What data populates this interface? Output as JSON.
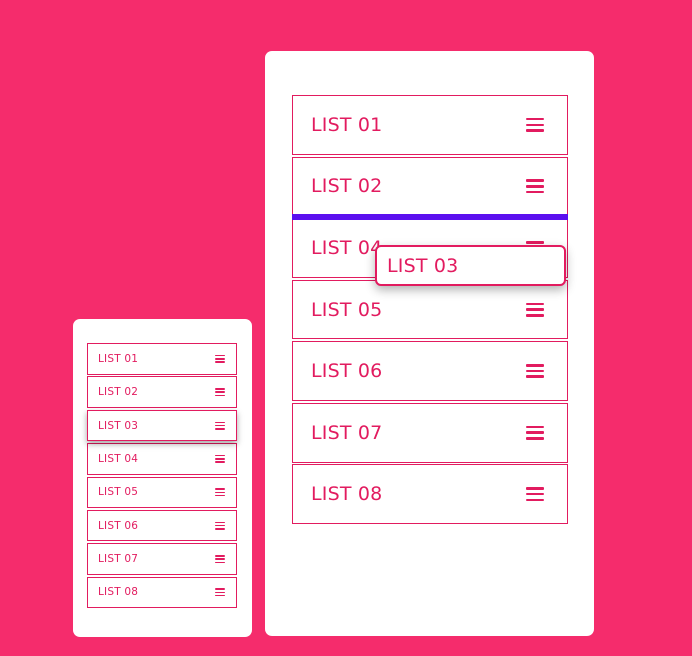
{
  "colors": {
    "background": "#F52C6C",
    "accent": "#E21B5F",
    "drop_indicator": "#5B0FEF",
    "card": "#FFFFFF"
  },
  "small_list": {
    "items": [
      {
        "label": "LIST 01",
        "icon": "drag-handle-icon"
      },
      {
        "label": "LIST 02",
        "icon": "drag-handle-icon"
      },
      {
        "label": "LIST 03",
        "icon": "drag-handle-icon",
        "selected": true
      },
      {
        "label": "LIST 04",
        "icon": "drag-handle-icon"
      },
      {
        "label": "LIST 05",
        "icon": "drag-handle-icon"
      },
      {
        "label": "LIST 06",
        "icon": "drag-handle-icon"
      },
      {
        "label": "LIST 07",
        "icon": "drag-handle-icon"
      },
      {
        "label": "LIST 08",
        "icon": "drag-handle-icon"
      }
    ]
  },
  "large_list": {
    "items": [
      {
        "label": "LIST 01",
        "icon": "drag-handle-icon"
      },
      {
        "label": "LIST 02",
        "icon": "drag-handle-icon"
      },
      {
        "label": "LIST 04",
        "icon": "drag-handle-icon"
      },
      {
        "label": "LIST 05",
        "icon": "drag-handle-icon"
      },
      {
        "label": "LIST 06",
        "icon": "drag-handle-icon"
      },
      {
        "label": "LIST 07",
        "icon": "drag-handle-icon"
      },
      {
        "label": "LIST 08",
        "icon": "drag-handle-icon"
      }
    ],
    "dragging": {
      "label": "LIST 03"
    }
  }
}
